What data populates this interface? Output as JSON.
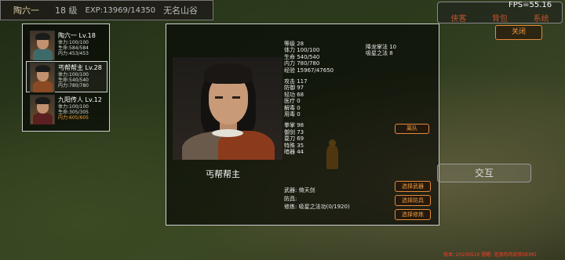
{
  "status_bar": {
    "name": "陶六一",
    "level": "18 级",
    "exp": "EXP:13969/14350",
    "location": "无名山谷"
  },
  "fps": "FPS=55.16",
  "top_right_menu": [
    "侠客",
    "背包",
    "系统"
  ],
  "roster": [
    {
      "name": "陶六一",
      "level": "Lv.18",
      "stamina": "体力:100/100",
      "hp": "生命:584/584",
      "mp": "内力:453/453",
      "selected": false
    },
    {
      "name": "丐帮帮主",
      "level": "Lv.28",
      "stamina": "体力:100/100",
      "hp": "生命:540/540",
      "mp": "内力:780/780",
      "selected": true
    },
    {
      "name": "九阳传人",
      "level": "Lv.12",
      "stamina": "体力:100/100",
      "hp": "生命:305/305",
      "mp": "内力:605/605",
      "selected": false
    }
  ],
  "character": {
    "name": "丐帮帮主",
    "stats": [
      "等级 28",
      "体力 100/100",
      "生命 540/540",
      "内力 780/780",
      "经验 15967/47650",
      "",
      "攻击 117",
      "防御 97",
      "轻功 68",
      "医疗 0",
      "解毒 0",
      "用毒 0",
      "",
      "拳掌 98",
      "御剑 73",
      "耍刀 69",
      "特殊 35",
      "暗器 44"
    ],
    "skills": [
      "降龙掌法 10",
      "吸星之法 8"
    ],
    "weapon": "武器: 倚天剑",
    "armor": "防具:",
    "training": "修炼: 吸星之法功(0/1920)"
  },
  "buttons": {
    "leave": "离队",
    "select_weapon": "选择武器",
    "select_armor": "选择防具",
    "select_training": "选择修炼",
    "close": "关闭",
    "interact": "交互"
  },
  "footer": "版本: 20230510  提醒: 无限肉鸡武侠DEMO",
  "colors": {
    "accent": "#f09a3e",
    "footer": "#ff3b2a",
    "panel_border": "#cfcfcf"
  }
}
